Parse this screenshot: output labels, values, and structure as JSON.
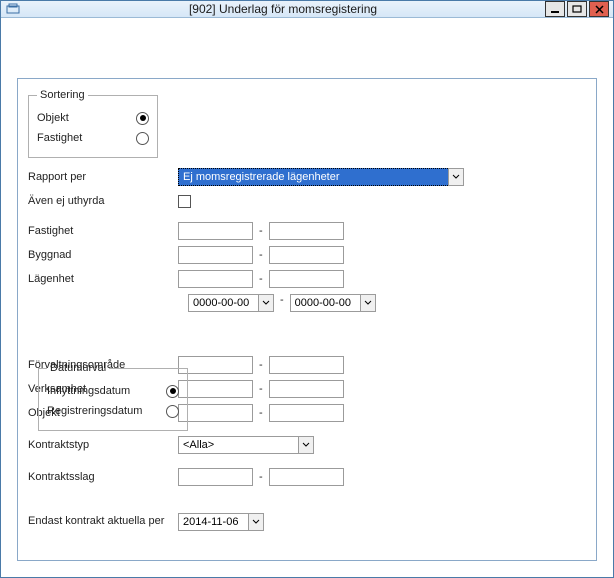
{
  "window": {
    "title": "[902]  Underlag för momsregistering"
  },
  "sortering": {
    "legend": "Sortering",
    "objekt": "Objekt",
    "fastighet": "Fastighet",
    "selected": "objekt"
  },
  "labels": {
    "rapport_per": "Rapport per",
    "aven_ej_uthyrda": "Även ej uthyrda",
    "fastighet": "Fastighet",
    "byggnad": "Byggnad",
    "lagenhet": "Lägenhet",
    "forvaltningsomrade": "Förvaltningsområde",
    "verksamhet": "Verksamhet",
    "objekt": "Objekt",
    "kontraktstyp": "Kontraktstyp",
    "kontraktsslag": "Kontraktsslag",
    "endast_kontrakt": "Endast kontrakt aktuella per"
  },
  "rapport_per": {
    "value": "Ej momsregistrerade lägenheter"
  },
  "datumurval": {
    "legend": "Datumurval",
    "inflyttning": "Inflyttningsdatum",
    "registrering": "Registreringsdatum",
    "selected": "inflyttning",
    "from": "0000-00-00",
    "to": "0000-00-00"
  },
  "kontraktstyp": {
    "value": "<Alla>"
  },
  "endast_kontrakt": {
    "value": "2014-11-06"
  },
  "ranges": {
    "fastighet_from": "",
    "fastighet_to": "",
    "byggnad_from": "",
    "byggnad_to": "",
    "lagenhet_from": "",
    "lagenhet_to": "",
    "forv_from": "",
    "forv_to": "",
    "verk_from": "",
    "verk_to": "",
    "objekt_from": "",
    "objekt_to": "",
    "kslag_from": "",
    "kslag_to": ""
  }
}
